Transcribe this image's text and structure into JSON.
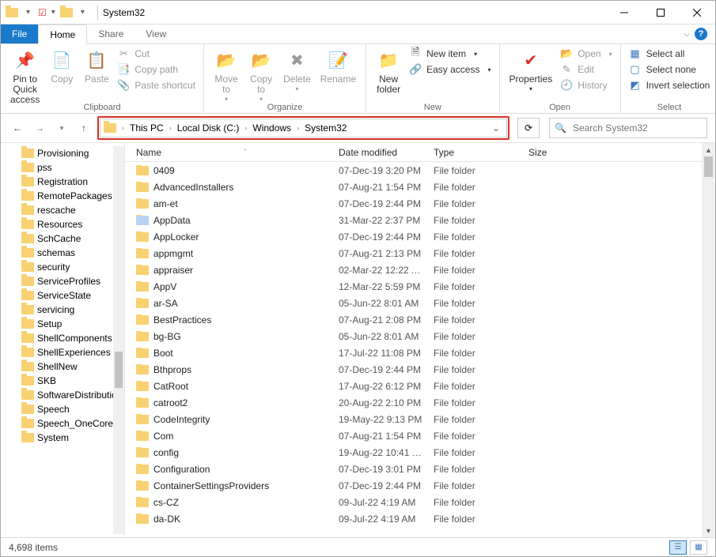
{
  "window": {
    "title": "System32"
  },
  "tabs": {
    "file": "File",
    "home": "Home",
    "share": "Share",
    "view": "View"
  },
  "ribbon": {
    "pin": "Pin to Quick\naccess",
    "copy": "Copy",
    "paste": "Paste",
    "cut": "Cut",
    "copypath": "Copy path",
    "pasteshortcut": "Paste shortcut",
    "clipboard_group": "Clipboard",
    "moveto": "Move\nto",
    "copyto": "Copy\nto",
    "delete": "Delete",
    "rename": "Rename",
    "organize_group": "Organize",
    "newfolder": "New\nfolder",
    "newitem": "New item",
    "easyaccess": "Easy access",
    "new_group": "New",
    "properties": "Properties",
    "open": "Open",
    "edit": "Edit",
    "history": "History",
    "open_group": "Open",
    "selectall": "Select all",
    "selectnone": "Select none",
    "invert": "Invert selection",
    "select_group": "Select"
  },
  "breadcrumb": [
    "This PC",
    "Local Disk (C:)",
    "Windows",
    "System32"
  ],
  "search": {
    "placeholder": "Search System32"
  },
  "columns": {
    "name": "Name",
    "date": "Date modified",
    "type": "Type",
    "size": "Size"
  },
  "tree": [
    "Provisioning",
    "pss",
    "Registration",
    "RemotePackages",
    "rescache",
    "Resources",
    "SchCache",
    "schemas",
    "security",
    "ServiceProfiles",
    "ServiceState",
    "servicing",
    "Setup",
    "ShellComponents",
    "ShellExperiences",
    "ShellNew",
    "SKB",
    "SoftwareDistribution",
    "Speech",
    "Speech_OneCore",
    "System"
  ],
  "rows": [
    {
      "name": "0409",
      "date": "07-Dec-19 3:20 PM",
      "type": "File folder"
    },
    {
      "name": "AdvancedInstallers",
      "date": "07-Aug-21 1:54 PM",
      "type": "File folder"
    },
    {
      "name": "am-et",
      "date": "07-Dec-19 2:44 PM",
      "type": "File folder"
    },
    {
      "name": "AppData",
      "date": "31-Mar-22 2:37 PM",
      "type": "File folder",
      "iconVariant": "app"
    },
    {
      "name": "AppLocker",
      "date": "07-Dec-19 2:44 PM",
      "type": "File folder"
    },
    {
      "name": "appmgmt",
      "date": "07-Aug-21 2:13 PM",
      "type": "File folder"
    },
    {
      "name": "appraiser",
      "date": "02-Mar-22 12:22 A...",
      "type": "File folder"
    },
    {
      "name": "AppV",
      "date": "12-Mar-22 5:59 PM",
      "type": "File folder"
    },
    {
      "name": "ar-SA",
      "date": "05-Jun-22 8:01 AM",
      "type": "File folder"
    },
    {
      "name": "BestPractices",
      "date": "07-Aug-21 2:08 PM",
      "type": "File folder"
    },
    {
      "name": "bg-BG",
      "date": "05-Jun-22 8:01 AM",
      "type": "File folder"
    },
    {
      "name": "Boot",
      "date": "17-Jul-22 11:08 PM",
      "type": "File folder"
    },
    {
      "name": "Bthprops",
      "date": "07-Dec-19 2:44 PM",
      "type": "File folder"
    },
    {
      "name": "CatRoot",
      "date": "17-Aug-22 6:12 PM",
      "type": "File folder"
    },
    {
      "name": "catroot2",
      "date": "20-Aug-22 2:10 PM",
      "type": "File folder"
    },
    {
      "name": "CodeIntegrity",
      "date": "19-May-22 9:13 PM",
      "type": "File folder"
    },
    {
      "name": "Com",
      "date": "07-Aug-21 1:54 PM",
      "type": "File folder"
    },
    {
      "name": "config",
      "date": "19-Aug-22 10:41 P...",
      "type": "File folder"
    },
    {
      "name": "Configuration",
      "date": "07-Dec-19 3:01 PM",
      "type": "File folder"
    },
    {
      "name": "ContainerSettingsProviders",
      "date": "07-Dec-19 2:44 PM",
      "type": "File folder"
    },
    {
      "name": "cs-CZ",
      "date": "09-Jul-22 4:19 AM",
      "type": "File folder"
    },
    {
      "name": "da-DK",
      "date": "09-Jul-22 4:19 AM",
      "type": "File folder"
    }
  ],
  "status": {
    "items": "4,698 items"
  }
}
